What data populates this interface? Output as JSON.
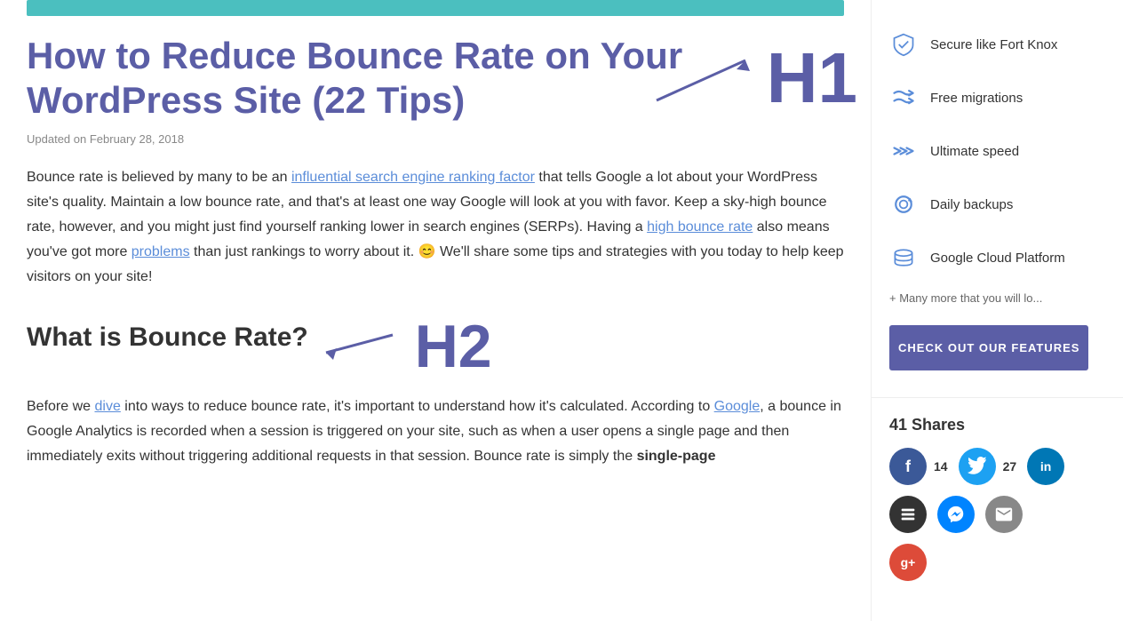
{
  "main": {
    "banner_alt": "Teal header banner",
    "article_title": "How to Reduce Bounce Rate on Your WordPress Site (22 Tips)",
    "article_meta": "Updated on February 28, 2018",
    "h1_label": "H1",
    "paragraph1": "Bounce rate is believed by many to be an influential search engine ranking factor that tells Google a lot about your WordPress site's quality. Maintain a low bounce rate, and that's at least one way Google will look at you with favor. Keep a sky-high bounce rate, however, and you might just find yourself ranking lower in search engines (SERPs). Having a high bounce rate also means you've got more problems than just rankings to worry about it. 😊 We'll share some tips and strategies with you today to help keep visitors on your site!",
    "h2_title": "What is Bounce Rate?",
    "h2_label": "H2",
    "paragraph2": "Before we dive into ways to reduce bounce rate, it's important to understand how it's calculated. According to Google, a bounce in Google Analytics is recorded when a session is triggered on your site, such as when a user opens a single page and then immediately exits without triggering additional requests in that session. Bounce rate is simply the",
    "paragraph2_link_dive": "dive",
    "paragraph2_link_google": "Google",
    "bold_text": "single-page"
  },
  "sidebar": {
    "features": [
      {
        "id": "secure",
        "label": "Secure like Fort Knox",
        "icon": "shield"
      },
      {
        "id": "migrations",
        "label": "Free migrations",
        "icon": "arrow-right-double"
      },
      {
        "id": "speed",
        "label": "Ultimate speed",
        "icon": "chevrons"
      },
      {
        "id": "backups",
        "label": "Daily backups",
        "icon": "refresh"
      },
      {
        "id": "cloud",
        "label": "Google Cloud Platform",
        "icon": "layers"
      }
    ],
    "more_text": "+ Many more that you will lo...",
    "cta_button": "CHECK OUT OUR FEATURES",
    "shares": {
      "total_label": "41 Shares",
      "total": 41,
      "facebook_count": 14,
      "twitter_count": 27
    }
  }
}
